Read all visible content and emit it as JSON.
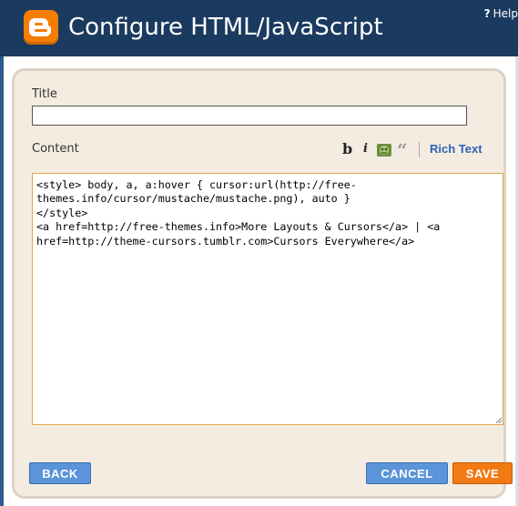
{
  "header": {
    "title": "Configure HTML/JavaScript",
    "help_label": "Help",
    "help_icon": "?"
  },
  "form": {
    "title_label": "Title",
    "title_value": "",
    "content_label": "Content",
    "content_value": "<style> body, a, a:hover { cursor:url(http://free-themes.info/cursor/mustache/mustache.png), auto }\n</style>\n<a href=http://free-themes.info>More Layouts & Cursors</a> | <a href=http://theme-cursors.tumblr.com>Cursors Everywhere</a>"
  },
  "toolbar": {
    "bold": "b",
    "italic": "i",
    "image_icon": "image-icon",
    "quote": "“",
    "rich_text": "Rich Text"
  },
  "buttons": {
    "back": "BACK",
    "cancel": "CANCEL",
    "save": "SAVE"
  },
  "colors": {
    "header_bg": "#1b3a5f",
    "logo": "#f57d00",
    "panel_bg": "#f4ece1",
    "blue_button": "#5b94d8",
    "save_button": "#f27a14",
    "link": "#2a63b8"
  }
}
